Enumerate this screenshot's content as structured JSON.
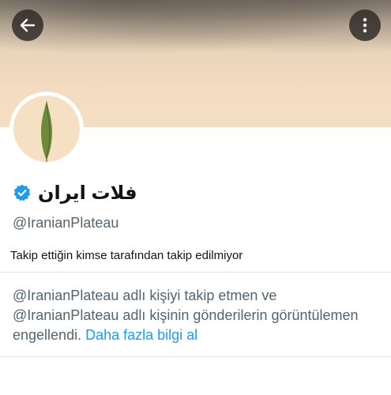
{
  "header": {
    "back_icon": "arrow-left-icon",
    "more_icon": "vertical-ellipsis-icon"
  },
  "profile": {
    "display_name": "فلات ایران",
    "verified_icon": "verified-badge-icon",
    "verified_color": "#1d9bf0",
    "handle": "@IranianPlateau",
    "follow_info": "Takip ettiğin kimse tarafından takip edilmiyor"
  },
  "blocked_notice": {
    "message": "@IranianPlateau adlı kişiyi takip etmen ve @IranianPlateau adlı kişinin gönderilerin görüntülemen engellendi.",
    "link_label": "Daha fazla bilgi al",
    "link_color": "#1d9bf0"
  }
}
